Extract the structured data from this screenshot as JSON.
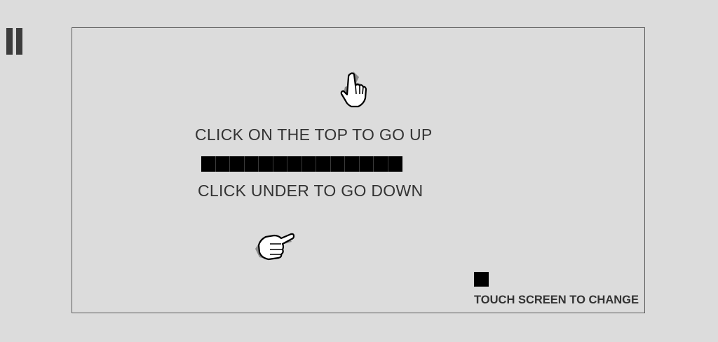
{
  "controls": {
    "pause_icon": "pause-icon"
  },
  "instructions": {
    "up_text": "CLICK ON THE TOP TO GO UP",
    "down_text": "CLICK UNDER TO GO DOWN",
    "up_icon": "hand-pointing-up-icon",
    "down_icon": "hand-pointing-right-icon"
  },
  "game": {
    "paddle_segments": 14,
    "ball_icon": "square-ball"
  },
  "footer": {
    "touch_hint": "TOUCH SCREEN TO CHANGE"
  },
  "colors": {
    "background": "#dcdcdc",
    "text": "#333333",
    "paddle": "#000000",
    "border": "#5a5a5a"
  }
}
